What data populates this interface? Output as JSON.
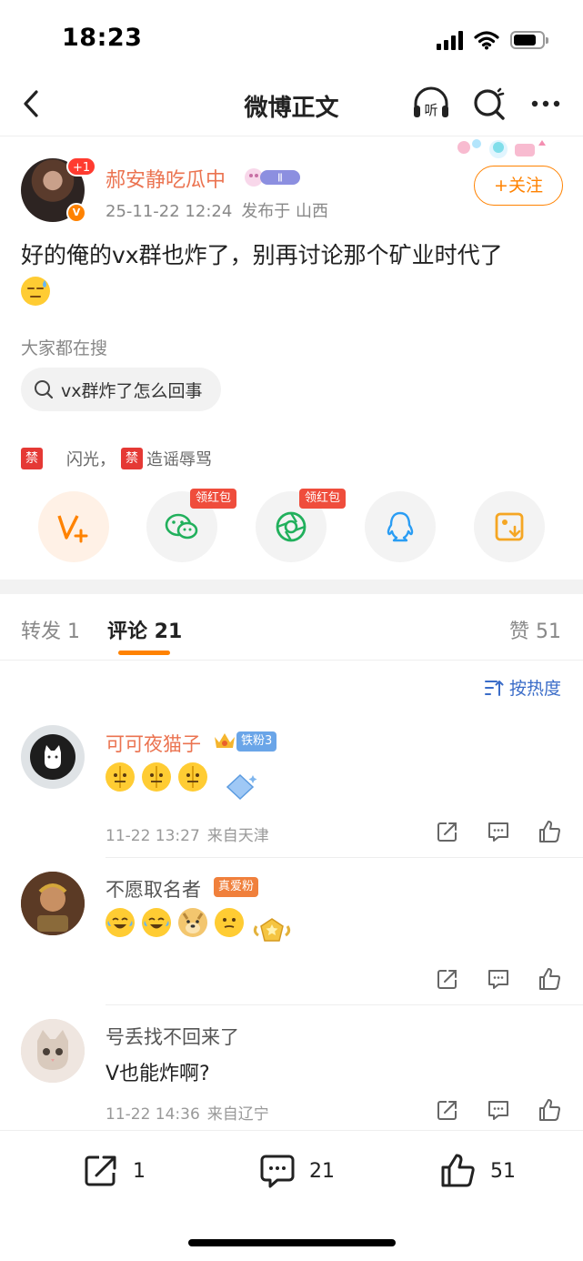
{
  "status_bar": {
    "time": "18:23",
    "battery_level": 0.8
  },
  "nav": {
    "title": "微博正文",
    "listen_label": "听"
  },
  "post": {
    "author": "郝安静吃瓜中",
    "avatar_badge": "+1",
    "member_badge": "Ⅱ",
    "verified": "V",
    "time": "25-11-22 12:24",
    "location": "发布于 山西",
    "follow_label": "+关注",
    "text": "好的俺的vx群也炸了，别再讨论那个矿业时代了"
  },
  "search_hint": {
    "label": "大家都在搜",
    "query": "vx群炸了怎么回事"
  },
  "tags": {
    "ban_mark": "禁",
    "frag1": "闪光，",
    "frag2": "造谣辱骂"
  },
  "share": {
    "hongbao_label": "领红包"
  },
  "tabs": {
    "repost": "转发 1",
    "comment": "评论 21",
    "like": "赞 51"
  },
  "sort_label": "按热度",
  "comments": [
    {
      "name": "可可夜猫子",
      "badge": "铁粉3",
      "time": "11-22 13:27",
      "location": "来自天津"
    },
    {
      "name": "不愿取名者",
      "badge": "真爱粉",
      "time": "",
      "location": ""
    },
    {
      "name": "号丢找不回来了",
      "text": "V也能炸啊?",
      "time": "11-22 14:36",
      "location": "来自辽宁"
    }
  ],
  "bottom_bar": {
    "reposts": "1",
    "comments": "21",
    "likes": "51"
  },
  "colors": {
    "accent": "#ff8200",
    "name_orange": "#eb7350",
    "link_blue": "#3a6cc8",
    "hongbao_red": "#ef4d3c"
  }
}
